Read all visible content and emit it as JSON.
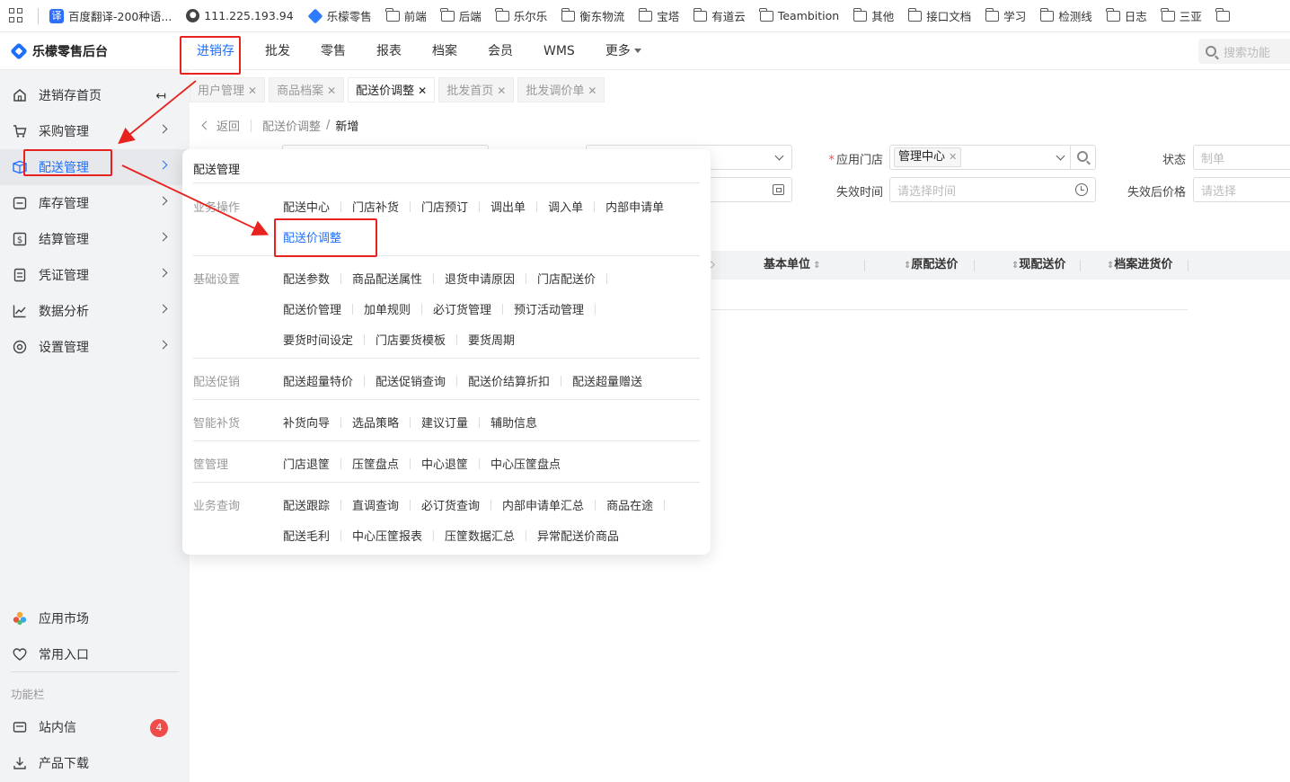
{
  "bookmarks": {
    "items": [
      {
        "label": "百度翻译-200种语...",
        "icon": "fanyi-icon"
      },
      {
        "label": "111.225.193.94",
        "icon": "globe-icon"
      },
      {
        "label": "乐檬零售",
        "icon": "lemeng-icon"
      },
      {
        "label": "前端",
        "icon": "folder-icon"
      },
      {
        "label": "后端",
        "icon": "folder-icon"
      },
      {
        "label": "乐尔乐",
        "icon": "folder-icon"
      },
      {
        "label": "衡东物流",
        "icon": "folder-icon"
      },
      {
        "label": "宝塔",
        "icon": "folder-icon"
      },
      {
        "label": "有道云",
        "icon": "folder-icon"
      },
      {
        "label": "Teambition",
        "icon": "folder-icon"
      },
      {
        "label": "其他",
        "icon": "folder-icon"
      },
      {
        "label": "接口文档",
        "icon": "folder-icon"
      },
      {
        "label": "学习",
        "icon": "folder-icon"
      },
      {
        "label": "检测线",
        "icon": "folder-icon"
      },
      {
        "label": "日志",
        "icon": "folder-icon"
      },
      {
        "label": "三亚",
        "icon": "folder-icon"
      }
    ]
  },
  "app": {
    "title": "乐檬零售后台"
  },
  "topnav": {
    "items": [
      "进销存",
      "批发",
      "零售",
      "报表",
      "档案",
      "会员",
      "WMS",
      "更多"
    ],
    "active": "进销存",
    "search_placeholder": "搜索功能"
  },
  "sidebar": {
    "items": [
      {
        "label": "进销存首页",
        "icon": "home-icon"
      },
      {
        "label": "采购管理",
        "icon": "cart-icon"
      },
      {
        "label": "配送管理",
        "icon": "delivery-icon"
      },
      {
        "label": "库存管理",
        "icon": "inventory-icon"
      },
      {
        "label": "结算管理",
        "icon": "settlement-icon"
      },
      {
        "label": "凭证管理",
        "icon": "voucher-icon"
      },
      {
        "label": "数据分析",
        "icon": "chart-icon"
      },
      {
        "label": "设置管理",
        "icon": "settings-icon"
      }
    ],
    "active": "配送管理",
    "bottom": [
      {
        "label": "应用市场",
        "icon": "app-market-icon"
      },
      {
        "label": "常用入口",
        "icon": "heart-icon"
      }
    ],
    "caption": "功能栏",
    "tools": [
      {
        "label": "站内信",
        "icon": "mail-icon",
        "badge": "4"
      },
      {
        "label": "产品下载",
        "icon": "download-icon"
      }
    ]
  },
  "tabs": [
    {
      "label": "用户管理",
      "active": false
    },
    {
      "label": "商品档案",
      "active": false
    },
    {
      "label": "配送价调整",
      "active": true
    },
    {
      "label": "批发首页",
      "active": false
    },
    {
      "label": "批发调价单",
      "active": false
    }
  ],
  "breadcrumb": {
    "back": "返回",
    "parent": "配送价调整",
    "separator": "/",
    "current": "新增"
  },
  "form": {
    "store_label": "应用门店",
    "store_tag": "管理中心",
    "status_label": "状态",
    "status_value": "制单",
    "expire_time_label": "失效时间",
    "expire_time_placeholder": "请选择时间",
    "after_price_label": "失效后价格",
    "after_price_placeholder": "请选择"
  },
  "table": {
    "columns": [
      "基本单位",
      "原配送价",
      "现配送价",
      "档案进货价"
    ]
  },
  "mega_menu": {
    "title": "配送管理",
    "sections": [
      {
        "category": "业务操作",
        "rows": [
          [
            "配送中心",
            "门店补货",
            "门店预订",
            "调出单",
            "调入单",
            "内部申请单"
          ],
          [
            "配送价调整"
          ]
        ]
      },
      {
        "category": "基础设置",
        "rows": [
          [
            "配送参数",
            "商品配送属性",
            "退货申请原因",
            "门店配送价"
          ],
          [
            "配送价管理",
            "加单规则",
            "必订货管理",
            "预订活动管理"
          ],
          [
            "要货时间设定",
            "门店要货模板",
            "要货周期"
          ]
        ]
      },
      {
        "category": "配送促销",
        "rows": [
          [
            "配送超量特价",
            "配送促销查询",
            "配送价结算折扣",
            "配送超量赠送"
          ]
        ]
      },
      {
        "category": "智能补货",
        "rows": [
          [
            "补货向导",
            "选品策略",
            "建议订量",
            "辅助信息"
          ]
        ]
      },
      {
        "category": "筐管理",
        "rows": [
          [
            "门店退筐",
            "压筐盘点",
            "中心退筐",
            "中心压筐盘点"
          ]
        ]
      },
      {
        "category": "业务查询",
        "rows": [
          [
            "配送跟踪",
            "直调查询",
            "必订货查询",
            "内部申请单汇总",
            "商品在途"
          ],
          [
            "配送毛利",
            "中心压筐报表",
            "压筐数据汇总",
            "异常配送价商品"
          ]
        ]
      }
    ],
    "selected": "配送价调整"
  },
  "colors": {
    "accent": "#1f6fff",
    "annotation": "#e8231f",
    "badge": "#f04b4b",
    "sidebar_bg": "#f2f3f5"
  }
}
